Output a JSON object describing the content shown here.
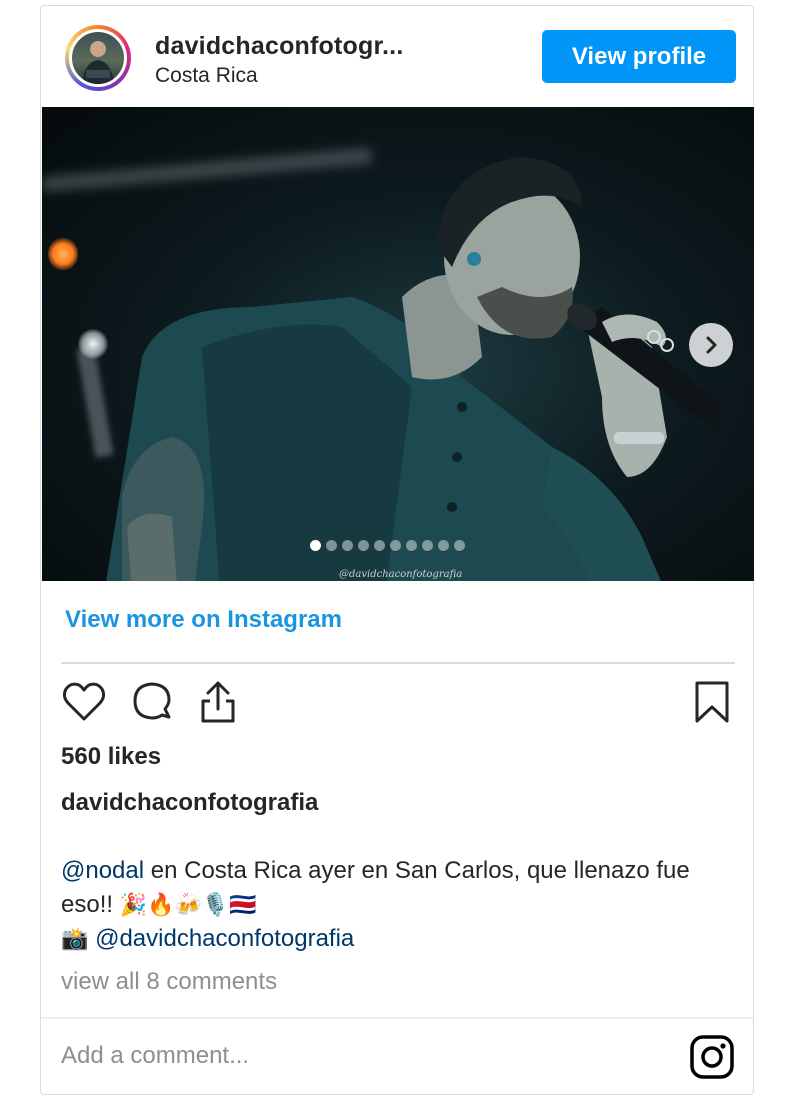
{
  "header": {
    "username": "davidchaconfotogr...",
    "location": "Costa Rica",
    "view_profile_label": "View profile"
  },
  "media": {
    "watermark": "@davidchaconfotografia",
    "carousel_count": 10,
    "active_index": 0
  },
  "view_more_label": "View more on Instagram",
  "likes": "560 likes",
  "post_username": "davidchaconfotografia",
  "caption": {
    "mention1": "@nodal",
    "text1": " en Costa Rica ayer en San Carlos, que llenazo fue eso!! ",
    "emojis1": "🎉🔥🍻🎙️🇨🇷",
    "camera_emoji": "📸",
    "mention2": "@davidchaconfotografia"
  },
  "comments_link": "view all 8 comments",
  "comment_placeholder": "Add a comment...",
  "colors": {
    "accent": "#0095f6",
    "link": "#1b95e0",
    "mention": "#00376b",
    "muted": "#8e8e8e"
  },
  "icons": [
    "heart-icon",
    "comment-icon",
    "share-icon",
    "bookmark-icon",
    "chevron-right-icon",
    "instagram-logo-icon"
  ]
}
